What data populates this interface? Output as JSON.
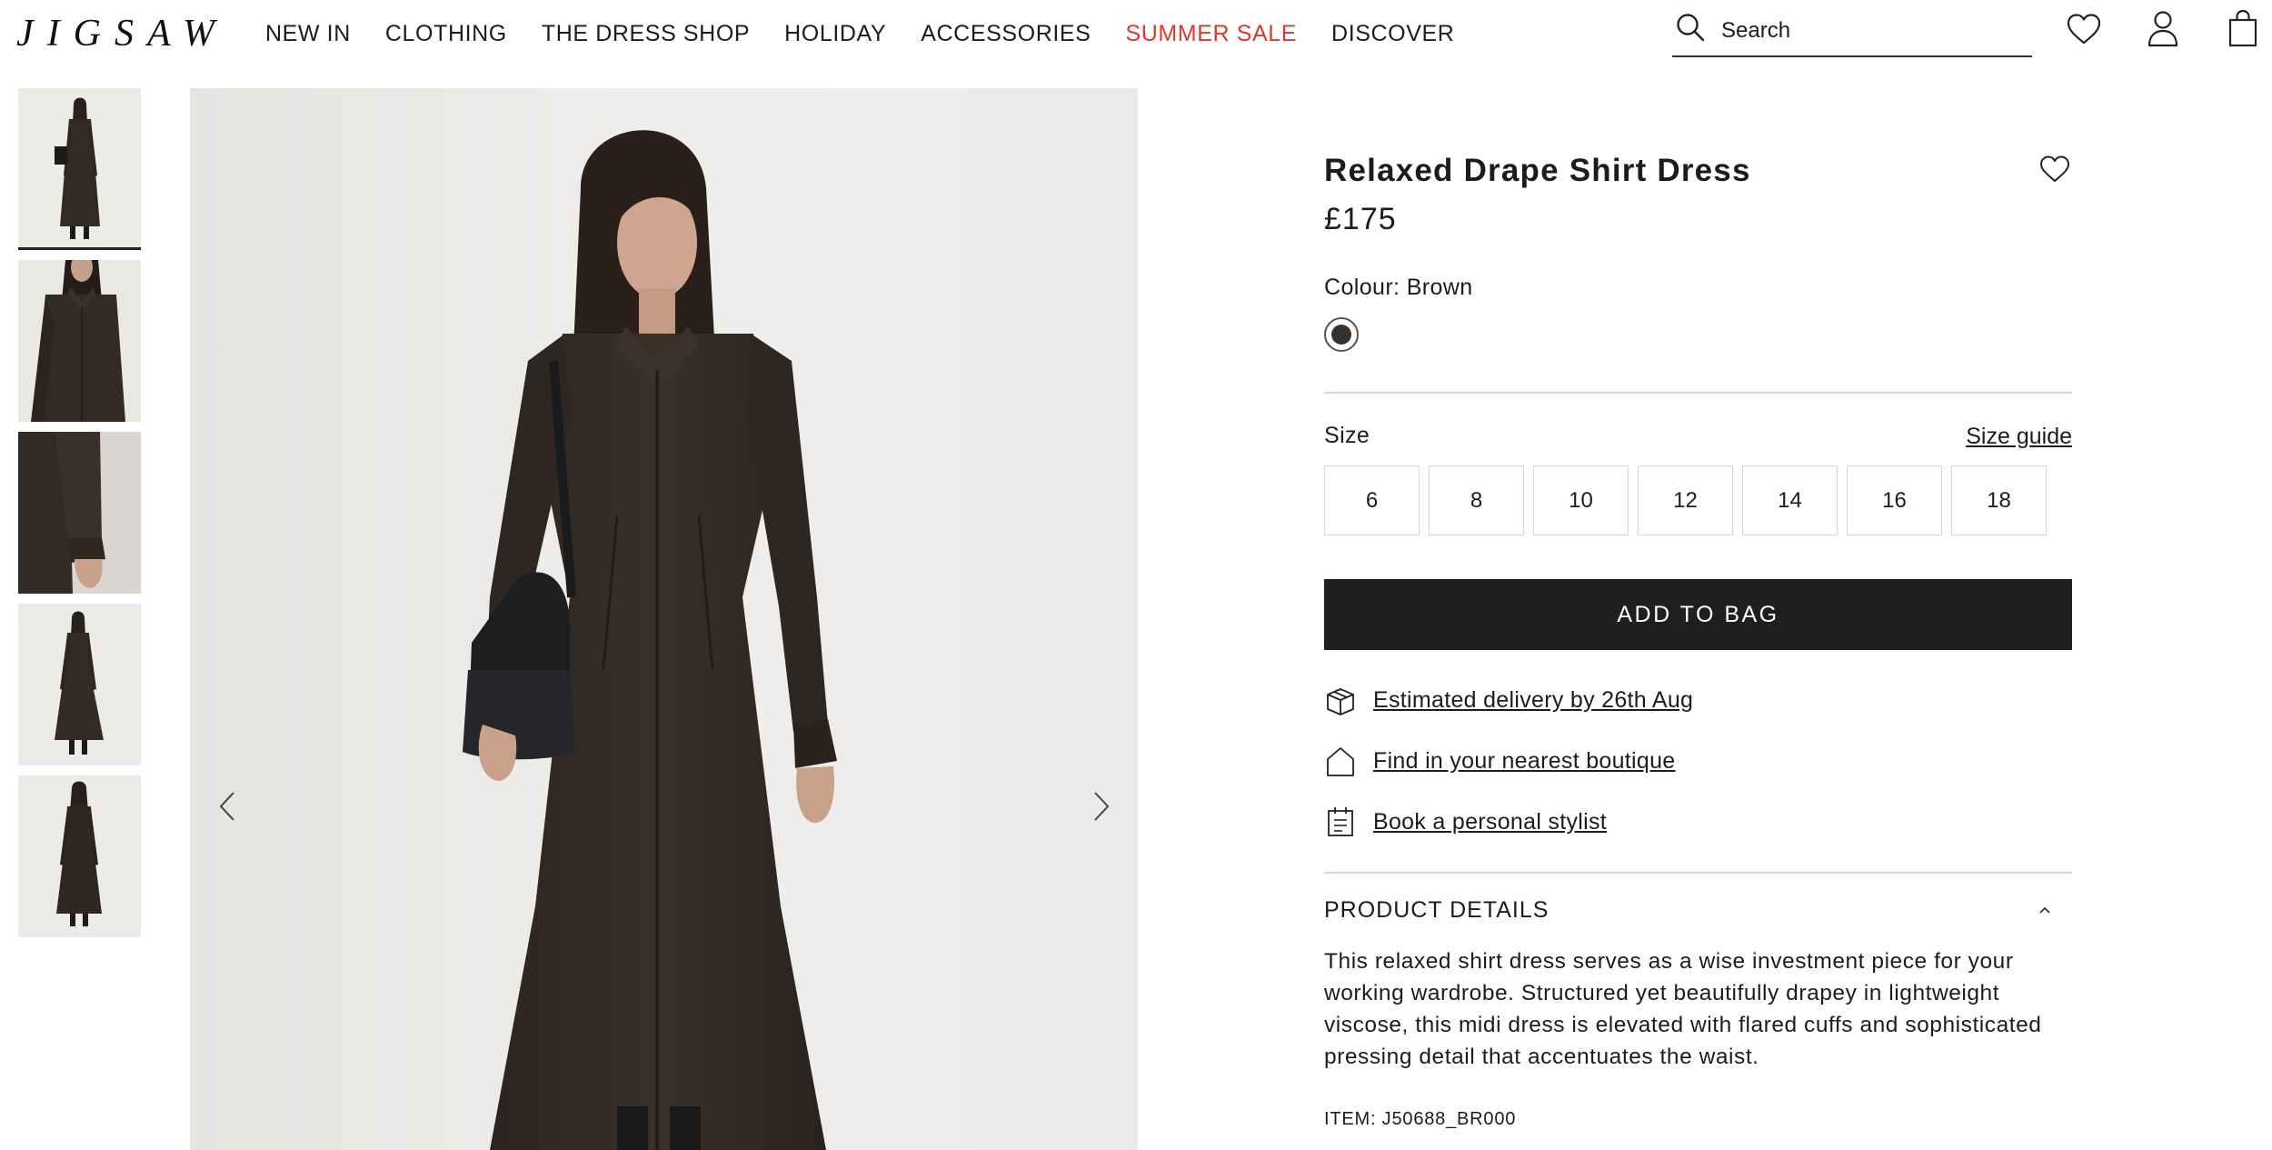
{
  "header": {
    "logo": "JIGSAW",
    "nav": [
      "NEW IN",
      "CLOTHING",
      "THE DRESS SHOP",
      "HOLIDAY",
      "ACCESSORIES",
      "SUMMER SALE",
      "DISCOVER"
    ],
    "search_placeholder": "Search",
    "icons": [
      "search-icon",
      "heart-icon",
      "account-icon",
      "bag-icon"
    ]
  },
  "gallery": {
    "thumbnail_count": 5,
    "active_thumbnail": 1,
    "controls": [
      "chevron-left-icon",
      "chevron-right-icon"
    ]
  },
  "product": {
    "title": "Relaxed Drape Shirt Dress",
    "price": "£175",
    "colour_label": "Colour: Brown",
    "swatch_color": "#3a2f2a",
    "size_label": "Size",
    "size_guide": "Size guide",
    "sizes": [
      "6",
      "8",
      "10",
      "12",
      "14",
      "16",
      "18"
    ],
    "add_to_bag": "ADD TO BAG",
    "delivery": "Estimated delivery by 26th Aug",
    "boutique": "Find in your nearest boutique",
    "stylist": "Book a personal stylist",
    "details_title": "PRODUCT DETAILS",
    "description": "This relaxed shirt dress serves as a wise investment piece for your working wardrobe. Structured yet beautifully drapey in lightweight viscose, this midi dress is elevated with flared cuffs and sophisticated pressing detail that accentuates the waist.",
    "item_code": "ITEM: J50688_BR000"
  },
  "colors": {
    "text": "#1c1c1c",
    "sale": "#d93a2b",
    "button_bg": "#1f1f1f",
    "divider": "#d4d4d4"
  }
}
